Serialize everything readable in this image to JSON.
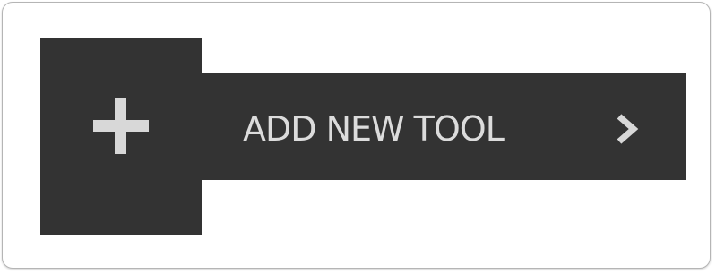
{
  "add_tool_button": {
    "label": "ADD NEW TOOL",
    "plus_icon": "plus-icon",
    "chevron_icon": "chevron-right-icon"
  },
  "colors": {
    "button_background": "#333333",
    "icon_and_text": "#dcdcdc",
    "card_border": "#b5b5b5",
    "page_background": "#ffffff"
  }
}
